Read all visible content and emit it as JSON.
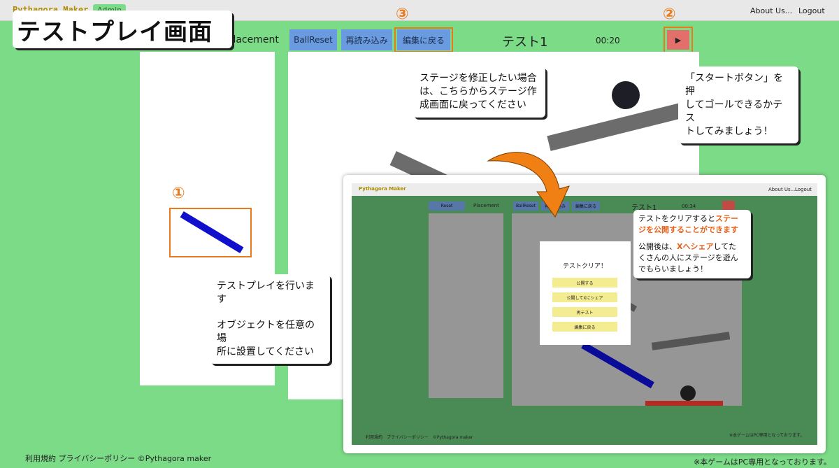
{
  "header": {
    "logo": "Pythagora Maker",
    "badge": "Admin",
    "about": "About Us...",
    "logout": "Logout"
  },
  "page_title": "テストプレイ画面",
  "toolbar": {
    "placement": "Placement",
    "ball_reset": "BallReset",
    "reload": "再読み込み",
    "back_to_edit": "編集に戻る",
    "stage_name": "テスト1",
    "timer": "00:20",
    "play_symbol": "▶"
  },
  "markers": {
    "one": "①",
    "two": "②",
    "three": "③"
  },
  "callouts": {
    "test_play": [
      "テストプレイを行います",
      "",
      "オブジェクトを任意の場",
      "所に設置してください"
    ],
    "start_button": [
      "「スタートボタン」を押",
      "してゴールできるかテス",
      "トしてみましょう！"
    ],
    "edit_back": [
      "ステージを修正したい場合",
      "は、こちらからステージ作",
      "成画面に戻ってください"
    ],
    "publish": {
      "line1_a": "テストをクリアすると",
      "line1_b": "ステー",
      "line2": "ジを公開することができます",
      "line3_a": "公開後は、",
      "line3_b": "Xへシェア",
      "line3_c": "してた",
      "line4": "くさんの人にステージを遊ん",
      "line5": "でもらいましょう！"
    }
  },
  "inset": {
    "logo": "Pythagora Maker",
    "about": "About Us...",
    "logout": "Logout",
    "reset": "Reset",
    "placement": "Placement",
    "ball_reset": "BallReset",
    "reload": "再読み込み",
    "back_to_edit": "編集に戻る",
    "stage_name": "テスト1",
    "timer": "00:34",
    "modal_title": "テストクリア！",
    "modal_buttons": [
      "公開する",
      "公開してXにシェア",
      "再テスト",
      "編集に戻る"
    ],
    "footer_left": "利用規約　プライバシーポリシー　©Pythagora maker",
    "footer_right": "※本ゲームはPC専用となっております。"
  },
  "footer": {
    "left": "利用規約  プライバシーポリシー  ©Pythagora maker",
    "right": "※本ゲームはPC専用となっております。"
  },
  "colors": {
    "background": "#7cdb87",
    "accent_orange": "#e87a1d",
    "button_blue": "#6a9be0",
    "play_red": "#e36f6a",
    "stick_blue": "#1010cc"
  }
}
